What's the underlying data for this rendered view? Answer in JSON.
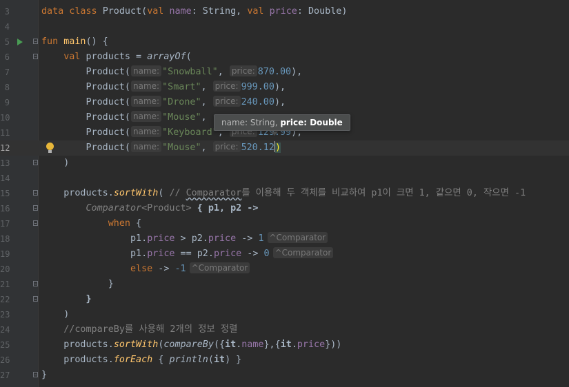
{
  "lines": [
    {
      "num": "3"
    },
    {
      "num": "4"
    },
    {
      "num": "5"
    },
    {
      "num": "6"
    },
    {
      "num": "7"
    },
    {
      "num": "8"
    },
    {
      "num": "9"
    },
    {
      "num": "10"
    },
    {
      "num": "11"
    },
    {
      "num": "12"
    },
    {
      "num": "13"
    },
    {
      "num": "14"
    },
    {
      "num": "15"
    },
    {
      "num": "16"
    },
    {
      "num": "17"
    },
    {
      "num": "18"
    },
    {
      "num": "19"
    },
    {
      "num": "20"
    },
    {
      "num": "21"
    },
    {
      "num": "22"
    },
    {
      "num": "23"
    },
    {
      "num": "24"
    },
    {
      "num": "25"
    },
    {
      "num": "26"
    },
    {
      "num": "27"
    }
  ],
  "code": {
    "l3": {
      "kw": "data class ",
      "cls": "Product(",
      "kw2": "val ",
      "p1": "name",
      "t1": ": String, ",
      "kw3": "val ",
      "p2": "price",
      "t2": ": Double)"
    },
    "l5": {
      "kw": "fun ",
      "fn": "main",
      "rest": "() {"
    },
    "l6": {
      "kw": "val ",
      "name": "products = ",
      "fn": "arrayOf",
      "rest": "("
    },
    "products": [
      {
        "open": "Product(",
        "hint_name": "name:",
        "name": "\"Snowball\"",
        "sep": ", ",
        "hint_price": "price:",
        "price": "870.00",
        "close": "),"
      },
      {
        "open": "Product(",
        "hint_name": "name:",
        "name": "\"Smart\"",
        "sep": ", ",
        "hint_price": "price:",
        "price": "999.00",
        "close": "),"
      },
      {
        "open": "Product(",
        "hint_name": "name:",
        "name": "\"Drone\"",
        "sep": ", ",
        "hint_price": "price:",
        "price": "240.00",
        "close": "),"
      },
      {
        "open": "Product(",
        "hint_name": "name:",
        "name": "\"Mouse\"",
        "sep": ",",
        "hint_price": "",
        "price": "",
        "close": ""
      },
      {
        "open": "Product(",
        "hint_name": "name:",
        "name": "\"Keyboard\"",
        "sep": ", ",
        "hint_price": "price:",
        "price": "129.99",
        "close": "),"
      },
      {
        "open": "Product(",
        "hint_name": "name:",
        "name": "\"Mouse\"",
        "sep": ", ",
        "hint_price": "price:",
        "price": "520.12",
        "close": ")"
      }
    ],
    "l13": ")",
    "l15": {
      "obj": "products.",
      "fn": "sortWith",
      "rest": "( ",
      "cmt1": "// ",
      "cmt_word": "Comparator",
      "cmt2": "를 이용해 두 객체를 비교하여 p1이 크면 1, 같으면 0, 작으면 -1"
    },
    "l16": {
      "iface": "Comparator",
      "type": "<Product>",
      "rest": " { p1, p2 ->"
    },
    "l17": {
      "kw": "when",
      "rest": " {"
    },
    "l18": {
      "a": "p1.",
      "ap": "price",
      "op": " > ",
      "b": "p2.",
      "bp": "price",
      "arrow": " -> ",
      "num": "1",
      "hint": "^Comparator"
    },
    "l19": {
      "a": "p1.",
      "ap": "price",
      "op": " == ",
      "b": "p2.",
      "bp": "price",
      "arrow": " -> ",
      "num": "0",
      "hint": "^Comparator"
    },
    "l20": {
      "kw": "else",
      "arrow": " -> ",
      "num": "-1",
      "hint": "^Comparator"
    },
    "l21": "}",
    "l22": "}",
    "l23": ")",
    "l24": "//compareBy를 사용해 2개의 정보 정렬",
    "l25": {
      "obj": "products.",
      "fn": "sortWith",
      "p1": "(",
      "fn2": "compareBy",
      "p2": "({",
      "it1": "it",
      "d1": ".",
      "prop1": "name",
      "mid": "},{",
      "it2": "it",
      "d2": ".",
      "prop2": "price",
      "end": "}))"
    },
    "l26": {
      "obj": "products.",
      "fn": "forEach",
      "p1": " { ",
      "fn2": "println",
      "p2": "(",
      "it": "it",
      "end": ") }"
    },
    "l27": "}"
  },
  "tooltip": {
    "params_inactive": "name: String, ",
    "param_active": "price: Double"
  }
}
